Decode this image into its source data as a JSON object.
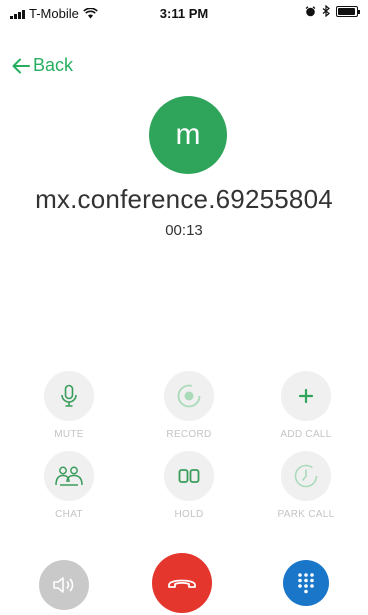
{
  "status_bar": {
    "carrier": "T-Mobile",
    "time": "3:11 PM"
  },
  "nav": {
    "back_label": "Back"
  },
  "call": {
    "avatar_letter": "m",
    "name": "mx.conference.69255804",
    "duration": "00:13"
  },
  "actions": [
    {
      "label": "MUTE",
      "icon": "microphone-icon"
    },
    {
      "label": "RECORD",
      "icon": "record-icon"
    },
    {
      "label": "ADD CALL",
      "icon": "plus-icon"
    },
    {
      "label": "CHAT",
      "icon": "chat-people-icon"
    },
    {
      "label": "HOLD",
      "icon": "hold-icon"
    },
    {
      "label": "PARK CALL",
      "icon": "park-timer-icon"
    }
  ],
  "bottom": {
    "speaker_icon": "speaker-icon",
    "end_call_icon": "hangup-phone-icon",
    "keypad_icon": "keypad-icon"
  },
  "colors": {
    "accent_green": "#2ea55a",
    "end_call_red": "#e5362d",
    "keypad_blue": "#1976c9",
    "disabled_label": "#c4c4c4"
  }
}
